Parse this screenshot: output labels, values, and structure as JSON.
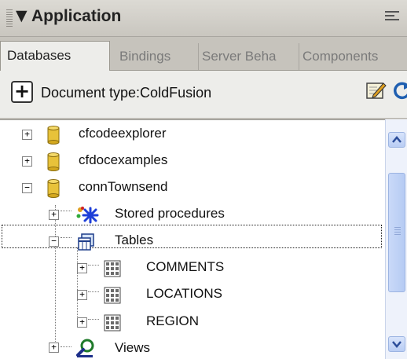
{
  "panel": {
    "title": "Application"
  },
  "tabs": [
    {
      "label": "Databases",
      "active": true
    },
    {
      "label": "Bindings",
      "active": false
    },
    {
      "label": "Server Beha",
      "active": false
    },
    {
      "label": "Components",
      "active": false
    }
  ],
  "toolbar": {
    "add_icon": "plus-icon",
    "doctype_label": "Document type:ColdFusion",
    "edit_icon": "edit-icon",
    "refresh_icon": "refresh-icon"
  },
  "tree": {
    "items": [
      {
        "label": "cfcodeexplorer",
        "expander": "+",
        "icon": "database-icon"
      },
      {
        "label": "cfdocexamples",
        "expander": "+",
        "icon": "database-icon"
      },
      {
        "label": "connTownsend",
        "expander": "−",
        "icon": "database-icon"
      },
      {
        "label": "Stored procedures",
        "expander": "+",
        "icon": "stored-procedures-icon"
      },
      {
        "label": "Tables",
        "expander": "−",
        "icon": "tables-icon",
        "selected": true
      },
      {
        "label": "COMMENTS",
        "expander": "+",
        "icon": "table-icon"
      },
      {
        "label": "LOCATIONS",
        "expander": "+",
        "icon": "table-icon"
      },
      {
        "label": "REGION",
        "expander": "+",
        "icon": "table-icon"
      },
      {
        "label": "Views",
        "expander": "+",
        "icon": "views-icon"
      }
    ]
  },
  "colors": {
    "panel_bg": "#d6d3ce",
    "tree_bg": "#ffffff",
    "scrollbar_accent": "#b9cdf4"
  }
}
